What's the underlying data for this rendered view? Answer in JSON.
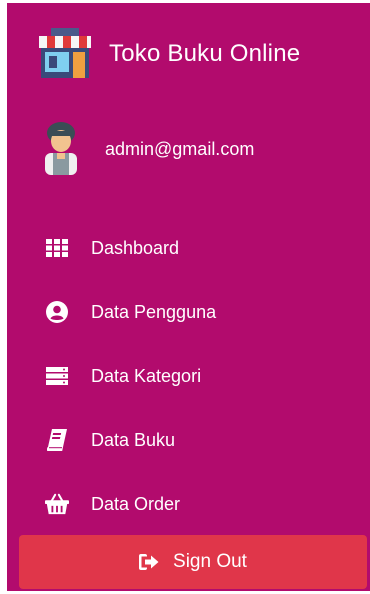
{
  "brand": {
    "title": "Toko Buku Online",
    "icon": "store-icon"
  },
  "user": {
    "email": "admin@gmail.com",
    "icon": "avatar"
  },
  "nav": [
    {
      "label": "Dashboard",
      "icon": "grid-icon"
    },
    {
      "label": "Data Pengguna",
      "icon": "user-circle-icon"
    },
    {
      "label": "Data Kategori",
      "icon": "server-icon"
    },
    {
      "label": "Data Buku",
      "icon": "book-icon"
    },
    {
      "label": "Data Order",
      "icon": "basket-icon"
    }
  ],
  "signout": {
    "label": "Sign Out",
    "icon": "sign-out-icon"
  },
  "colors": {
    "sidebar": "#b20b6d",
    "signout": "#e0364a",
    "text": "#ffffff"
  }
}
